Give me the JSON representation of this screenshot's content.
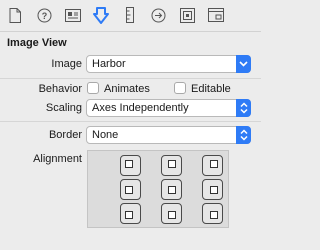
{
  "toolbar": {
    "tabs": [
      {
        "name": "file-inspector",
        "icon": "document-icon"
      },
      {
        "name": "quick-help",
        "icon": "question-circle-icon"
      },
      {
        "name": "identity-inspector",
        "icon": "identity-card-icon"
      },
      {
        "name": "attributes-inspector",
        "icon": "shield-down-arrow-icon",
        "selected": true
      },
      {
        "name": "size-inspector",
        "icon": "ruler-icon"
      },
      {
        "name": "connections-inspector",
        "icon": "arrow-circle-icon"
      },
      {
        "name": "bindings-inspector",
        "icon": "nested-squares-icon"
      },
      {
        "name": "view-effects-inspector",
        "icon": "window-icon"
      }
    ],
    "selected_color": "#2e7bf6"
  },
  "section": {
    "title": "Image View"
  },
  "image": {
    "label": "Image",
    "value": "Harbor"
  },
  "behavior": {
    "label": "Behavior",
    "animates": {
      "label": "Animates",
      "checked": false
    },
    "editable": {
      "label": "Editable",
      "checked": false
    }
  },
  "scaling": {
    "label": "Scaling",
    "value": "Axes Independently"
  },
  "border": {
    "label": "Border",
    "value": "None"
  },
  "alignment": {
    "label": "Alignment",
    "cells": [
      "top-left",
      "top",
      "top-right",
      "left",
      "center",
      "right",
      "bottom-left",
      "bottom",
      "bottom-right"
    ]
  }
}
